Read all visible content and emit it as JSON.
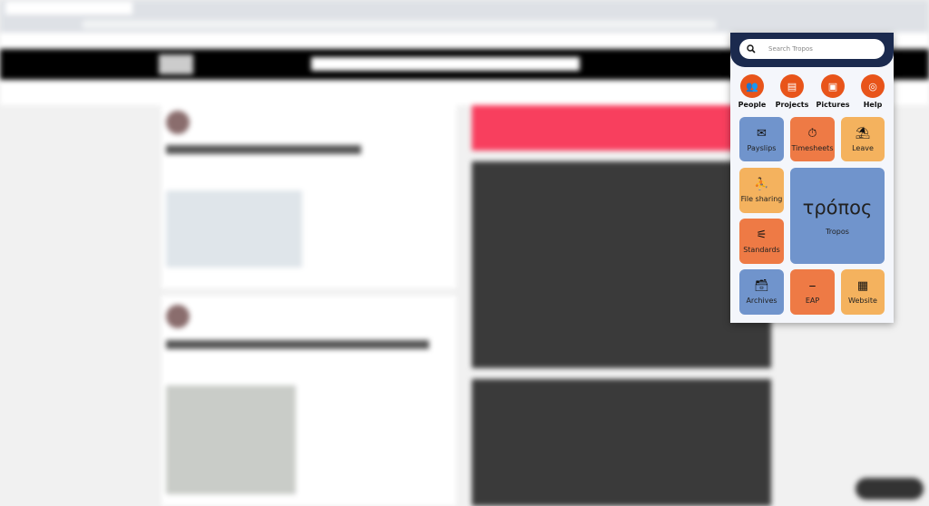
{
  "popup": {
    "search_placeholder": "Search Tropos",
    "quick_actions": [
      {
        "label": "People",
        "icon": "people-icon"
      },
      {
        "label": "Projects",
        "icon": "projects-icon"
      },
      {
        "label": "Pictures",
        "icon": "pictures-icon"
      },
      {
        "label": "Help",
        "icon": "lifebuoy-icon"
      }
    ],
    "tiles": {
      "payslips": "Payslips",
      "timesheets": "Timesheets",
      "leave": "Leave",
      "file_sharing": "File sharing",
      "standards": "Standards",
      "tropos_logo": "τρόπος",
      "tropos": "Tropos",
      "archives": "Archives",
      "eap": "EAP",
      "website": "Website"
    },
    "colors": {
      "header": "#1b2a4e",
      "accent": "#e8541a",
      "blue": "#7094cc",
      "orange": "#ee7a45",
      "light_orange": "#f4b25e"
    }
  }
}
